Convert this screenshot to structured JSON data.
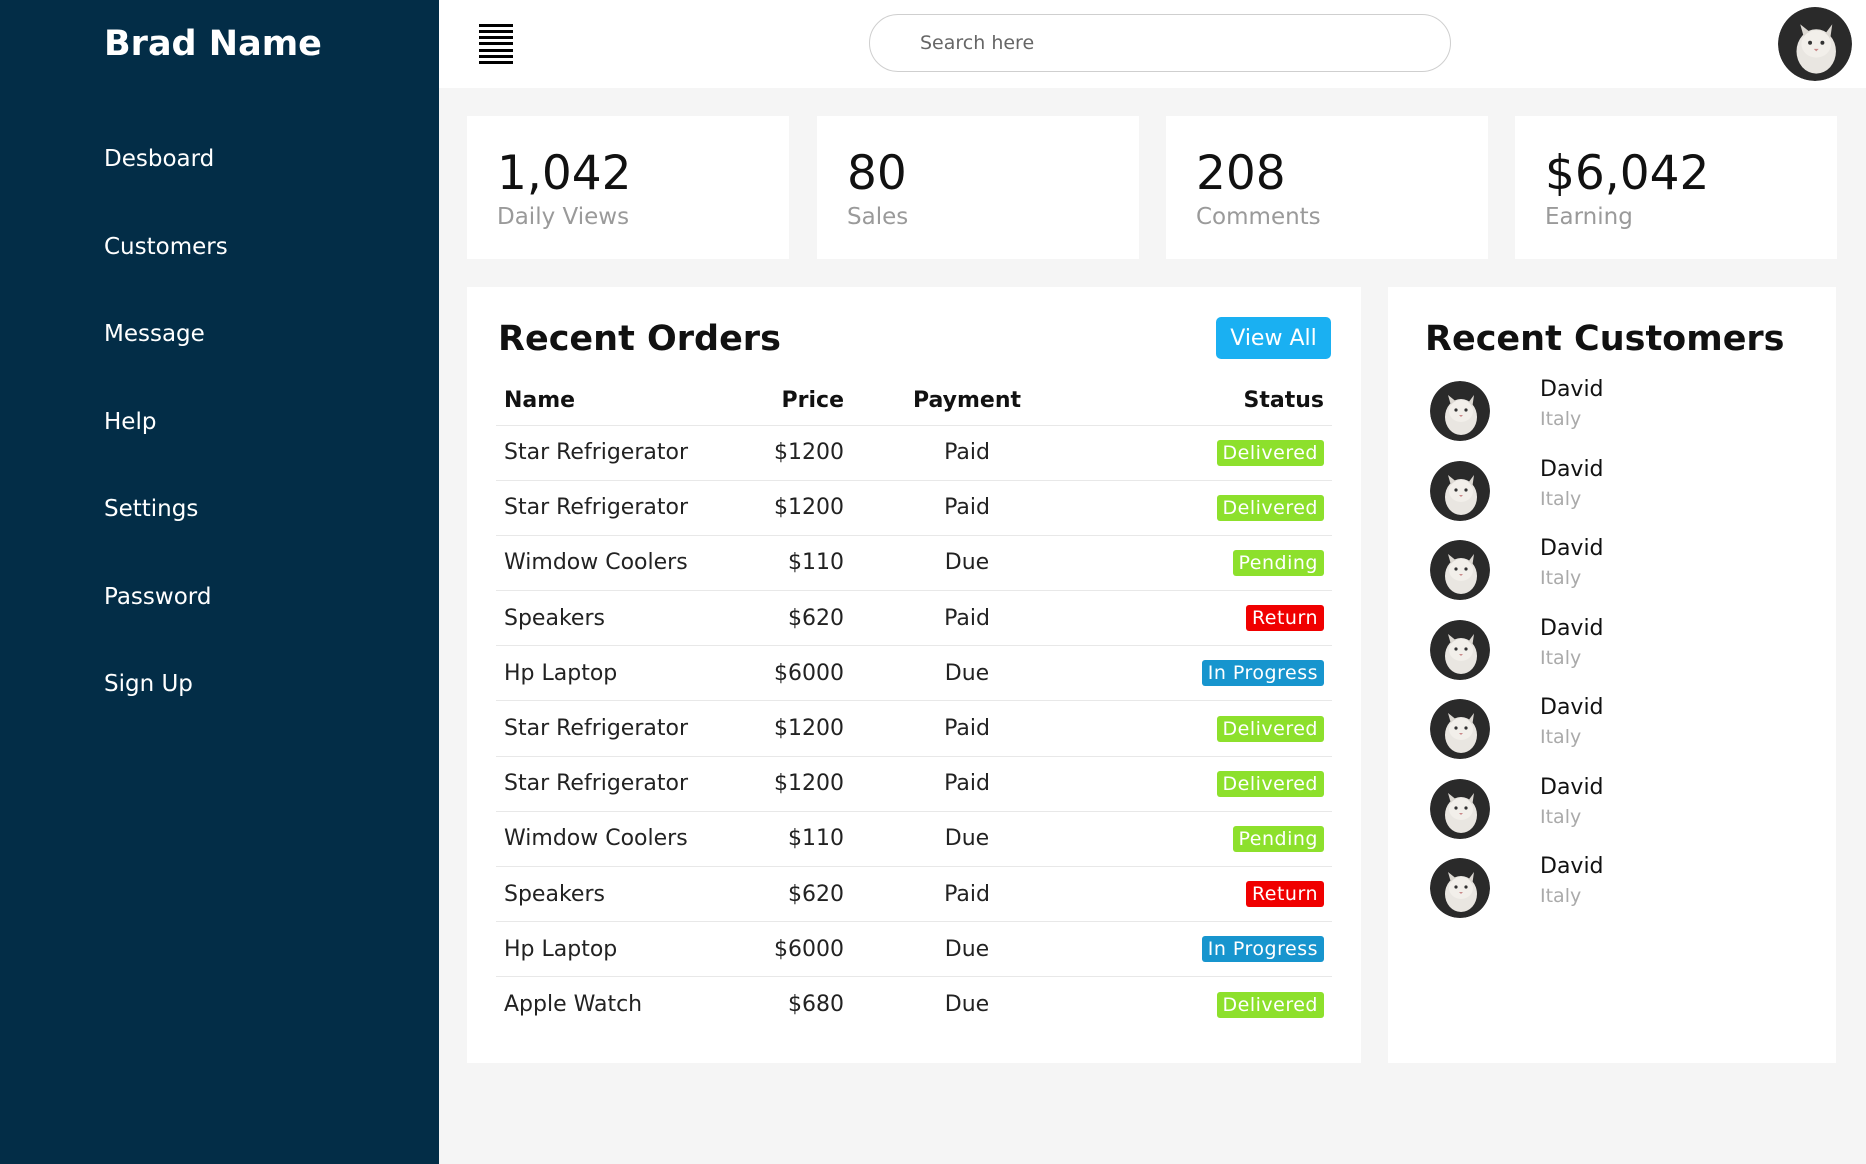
{
  "brand": "Brad Name",
  "sidebar": {
    "items": [
      {
        "label": "Desboard"
      },
      {
        "label": "Customers"
      },
      {
        "label": "Message"
      },
      {
        "label": "Help"
      },
      {
        "label": "Settings"
      },
      {
        "label": "Password"
      },
      {
        "label": "Sign Up"
      }
    ]
  },
  "topbar": {
    "menu_icon": "menu-icon",
    "search_placeholder": "Search here",
    "avatar_icon": "user-avatar"
  },
  "stats": [
    {
      "value": "1,042",
      "label": "Daily Views"
    },
    {
      "value": "80",
      "label": "Sales"
    },
    {
      "value": "208",
      "label": "Comments"
    },
    {
      "value": "$6,042",
      "label": "Earning"
    }
  ],
  "orders": {
    "title": "Recent Orders",
    "view_all_label": "View All",
    "headers": {
      "name": "Name",
      "price": "Price",
      "payment": "Payment",
      "status": "Status"
    },
    "rows": [
      {
        "name": "Star Refrigerator",
        "price": "$1200",
        "payment": "Paid",
        "status": "Delivered"
      },
      {
        "name": "Star Refrigerator",
        "price": "$1200",
        "payment": "Paid",
        "status": "Delivered"
      },
      {
        "name": "Wimdow Coolers",
        "price": "$110",
        "payment": "Due",
        "status": "Pending"
      },
      {
        "name": "Speakers",
        "price": "$620",
        "payment": "Paid",
        "status": "Return"
      },
      {
        "name": "Hp Laptop",
        "price": "$6000",
        "payment": "Due",
        "status": "In Progress"
      },
      {
        "name": "Star Refrigerator",
        "price": "$1200",
        "payment": "Paid",
        "status": "Delivered"
      },
      {
        "name": "Star Refrigerator",
        "price": "$1200",
        "payment": "Paid",
        "status": "Delivered"
      },
      {
        "name": "Wimdow Coolers",
        "price": "$110",
        "payment": "Due",
        "status": "Pending"
      },
      {
        "name": "Speakers",
        "price": "$620",
        "payment": "Paid",
        "status": "Return"
      },
      {
        "name": "Hp Laptop",
        "price": "$6000",
        "payment": "Due",
        "status": "In Progress"
      },
      {
        "name": "Apple Watch",
        "price": "$680",
        "payment": "Due",
        "status": "Delivered"
      }
    ]
  },
  "status_colors": {
    "Delivered": "#8de02c",
    "Pending": "#8de02c",
    "Return": "#f00000",
    "In Progress": "#1795ce"
  },
  "customers": {
    "title": "Recent Customers",
    "items": [
      {
        "name": "David",
        "country": "Italy"
      },
      {
        "name": "David",
        "country": "Italy"
      },
      {
        "name": "David",
        "country": "Italy"
      },
      {
        "name": "David",
        "country": "Italy"
      },
      {
        "name": "David",
        "country": "Italy"
      },
      {
        "name": "David",
        "country": "Italy"
      },
      {
        "name": "David",
        "country": "Italy"
      }
    ]
  },
  "colors": {
    "sidebar_bg": "#032d47",
    "accent": "#1ab0f2",
    "page_bg": "#f5f5f5"
  }
}
